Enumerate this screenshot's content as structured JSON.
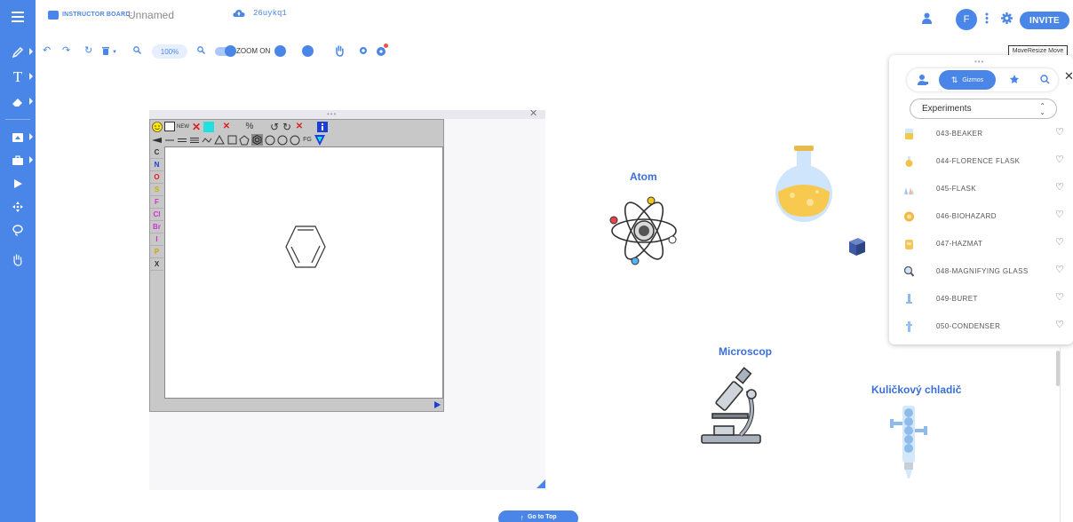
{
  "header": {
    "title_prefix": "INSTRUCTOR BOARD:",
    "board_name": "Unnamed",
    "board_code": "26uykq1",
    "avatar_initial": "F",
    "invite_label": "INVITE"
  },
  "toolbar": {
    "zoom_level": "100%",
    "zoom_toggle_label": "ZOOM ON",
    "tooltip": "MoveResize Move"
  },
  "editor": {
    "new_label": "NEW",
    "fg_label": "FG",
    "atoms": [
      {
        "symbol": "C",
        "color": "#333333"
      },
      {
        "symbol": "N",
        "color": "#1a3fd6"
      },
      {
        "symbol": "O",
        "color": "#e02020"
      },
      {
        "symbol": "S",
        "color": "#c9b400"
      },
      {
        "symbol": "F",
        "color": "#cc33cc"
      },
      {
        "symbol": "Cl",
        "color": "#cc33cc"
      },
      {
        "symbol": "Br",
        "color": "#cc33cc"
      },
      {
        "symbol": "I",
        "color": "#cc33cc"
      },
      {
        "symbol": "P",
        "color": "#d4a000"
      },
      {
        "symbol": "X",
        "color": "#333333"
      }
    ]
  },
  "board": {
    "gizmo_atom_label": "Atom",
    "gizmo_microscope_label": "Microscop",
    "gizmo_condenser_label": "Kuličkový chladič"
  },
  "panel": {
    "active_tab_label": "Gizmos",
    "category": "Experiments",
    "items": [
      {
        "label": "043-BEAKER",
        "icon": "beaker-icon",
        "color": "#f0c94a"
      },
      {
        "label": "044-FLORENCE FLASK",
        "icon": "florence-flask-icon",
        "color": "#f2c14e"
      },
      {
        "label": "045-FLASK",
        "icon": "flask-icon",
        "color": "#9cc4f0"
      },
      {
        "label": "046-BIOHAZARD",
        "icon": "biohazard-icon",
        "color": "#f5b942"
      },
      {
        "label": "047-HAZMAT",
        "icon": "hazmat-icon",
        "color": "#f4c65a"
      },
      {
        "label": "048-MAGNIFYING GLASS",
        "icon": "magnifying-glass-icon",
        "color": "#7a8a9c"
      },
      {
        "label": "049-BURET",
        "icon": "buret-icon",
        "color": "#8fb8ec"
      },
      {
        "label": "050-CONDENSER",
        "icon": "condenser-icon",
        "color": "#8fc1f2"
      }
    ]
  },
  "footer": {
    "goto_top_label": "Go to Top"
  },
  "colors": {
    "accent": "#4a86e8"
  }
}
